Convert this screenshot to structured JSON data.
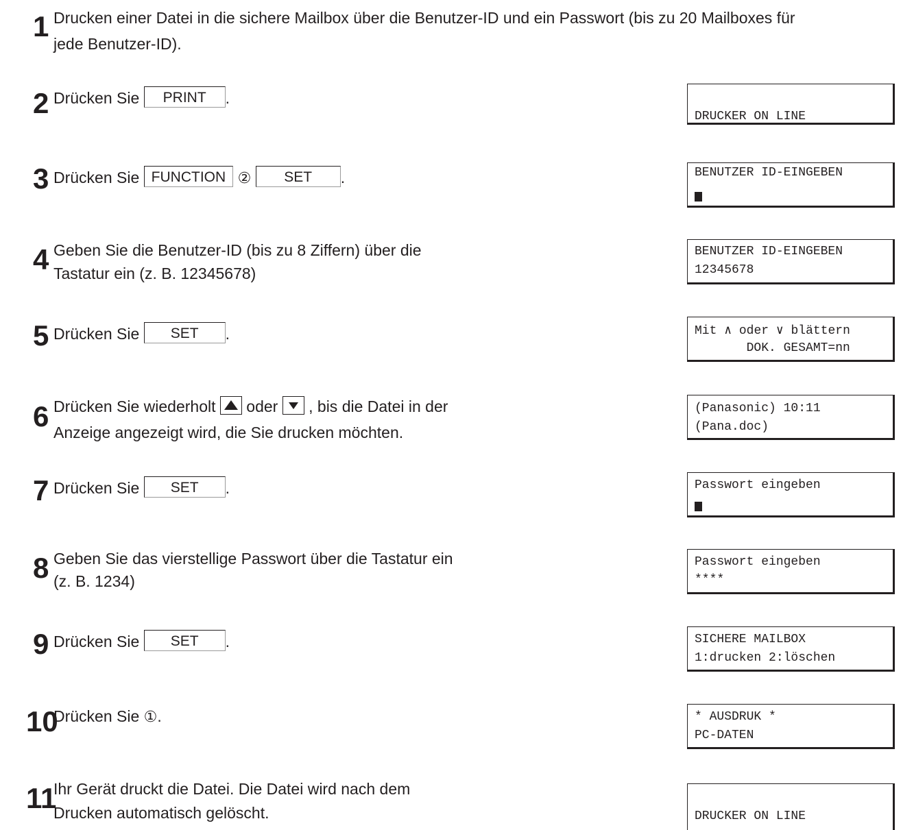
{
  "steps": [
    {
      "num": "1",
      "text_a": "Drucken einer Datei in die sichere Mailbox über die Benutzer-ID und ein Passwort (bis zu 20 Mailboxes für",
      "text_b": "jede Benutzer-ID)."
    },
    {
      "num": "2",
      "prefix": "Drücken Sie",
      "key": "PRINT",
      "suffix": "."
    },
    {
      "num": "3",
      "prefix": "Drücken Sie",
      "key_fn": "FUNCTION",
      "circled": "②",
      "key": "SET",
      "suffix": "."
    },
    {
      "num": "4",
      "text_a": "Geben Sie die Benutzer-ID (bis zu 8 Ziffern) über die",
      "text_b": "Tastatur ein (z. B. 12345678)"
    },
    {
      "num": "5",
      "prefix": "Drücken Sie",
      "key": "SET",
      "suffix": "."
    },
    {
      "num": "6",
      "prefix": "Drücken Sie wiederholt",
      "mid": "oder",
      "suffix": ", bis die Datei in der",
      "text_b": "Anzeige angezeigt wird, die Sie drucken möchten."
    },
    {
      "num": "7",
      "prefix": "Drücken Sie",
      "key": "SET",
      "suffix": "."
    },
    {
      "num": "8",
      "text_a": "Geben Sie das vierstellige Passwort über die Tastatur ein",
      "text_b": "(z. B. 1234)"
    },
    {
      "num": "9",
      "prefix": "Drücken Sie",
      "key": "SET",
      "suffix": "."
    },
    {
      "num": "10",
      "prefix": "Drücken Sie",
      "circled": "①",
      "suffix": "."
    },
    {
      "num": "11",
      "text_a": "Ihr Gerät druckt die Datei. Die Datei wird nach dem",
      "text_b": "Drucken automatisch gelöscht."
    }
  ],
  "icons": {
    "up": "up-arrow-key-icon",
    "down": "down-arrow-key-icon"
  },
  "displays": [
    {
      "line1": "",
      "line2": "DRUCKER ON LINE"
    },
    {
      "line1": "BENUTZER ID-EINGEBEN",
      "line2": ""
    },
    {
      "line1": "BENUTZER ID-EINGEBEN",
      "line2": "12345678"
    },
    {
      "line1": "Mit ∧ oder ∨ blättern",
      "line2": "       DOK. GESAMT=nn"
    },
    {
      "line1": "(Panasonic) 10:11",
      "line2": "(Pana.doc)"
    },
    {
      "line1": "Passwort eingeben",
      "line2": ""
    },
    {
      "line1": "Passwort eingeben",
      "line2": "****"
    },
    {
      "line1": "SICHERE MAILBOX",
      "line2": "1:drucken 2:löschen"
    },
    {
      "line1": "* AUSDRUK *",
      "line2": "PC-DATEN"
    },
    {
      "line1": "",
      "line2": "DRUCKER ON LINE"
    }
  ]
}
